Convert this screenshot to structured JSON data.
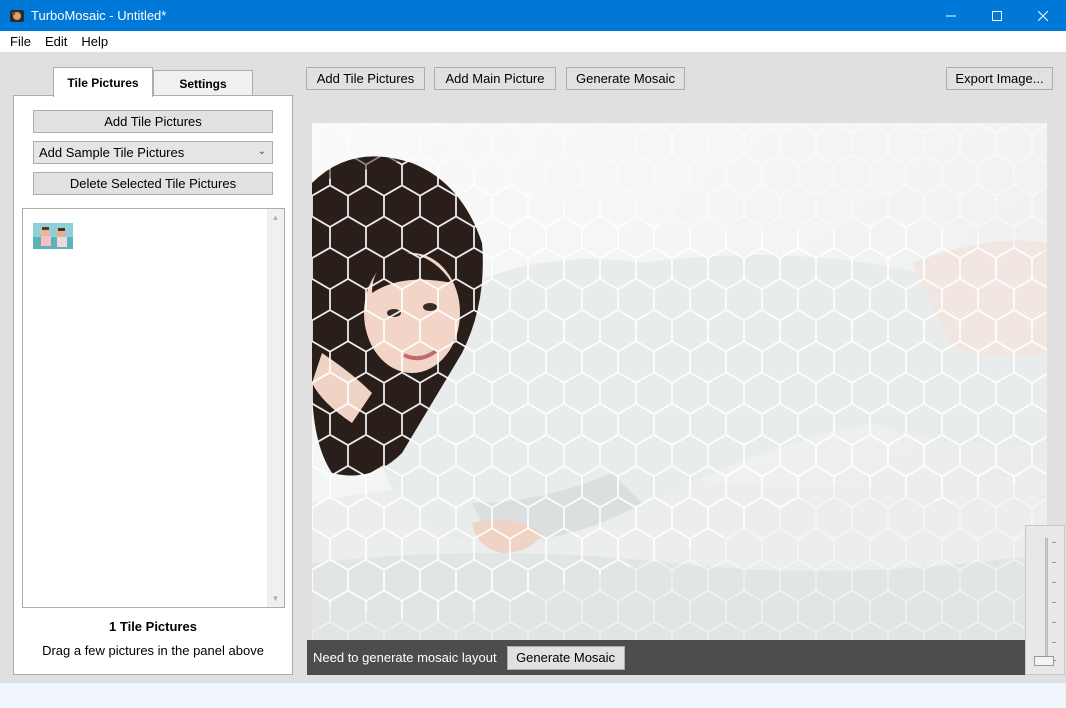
{
  "window": {
    "title": "TurboMosaic - Untitled*",
    "accent_color": "#0078d7",
    "controls": [
      "minimize-icon",
      "maximize-icon",
      "close-icon"
    ]
  },
  "menu": {
    "items": [
      "File",
      "Edit",
      "Help"
    ]
  },
  "tabs": [
    {
      "label": "Tile Pictures",
      "active": true
    },
    {
      "label": "Settings",
      "active": false
    }
  ],
  "left_panel": {
    "add_tile_button": "Add Tile Pictures",
    "sample_combo": "Add Sample Tile Pictures",
    "delete_button": "Delete Selected Tile Pictures",
    "tile_count": "1 Tile Pictures",
    "hint": "Drag a few pictures in the panel above"
  },
  "toolbar": {
    "add_tile_label": "Add Tile Pictures",
    "add_main_label": "Add Main Picture",
    "generate_label": "Generate Mosaic",
    "export_label": "Export Image..."
  },
  "info_bar": {
    "message": "Need to generate mosaic layout",
    "button_label": "Generate Mosaic",
    "background": "#4d4d4d"
  }
}
